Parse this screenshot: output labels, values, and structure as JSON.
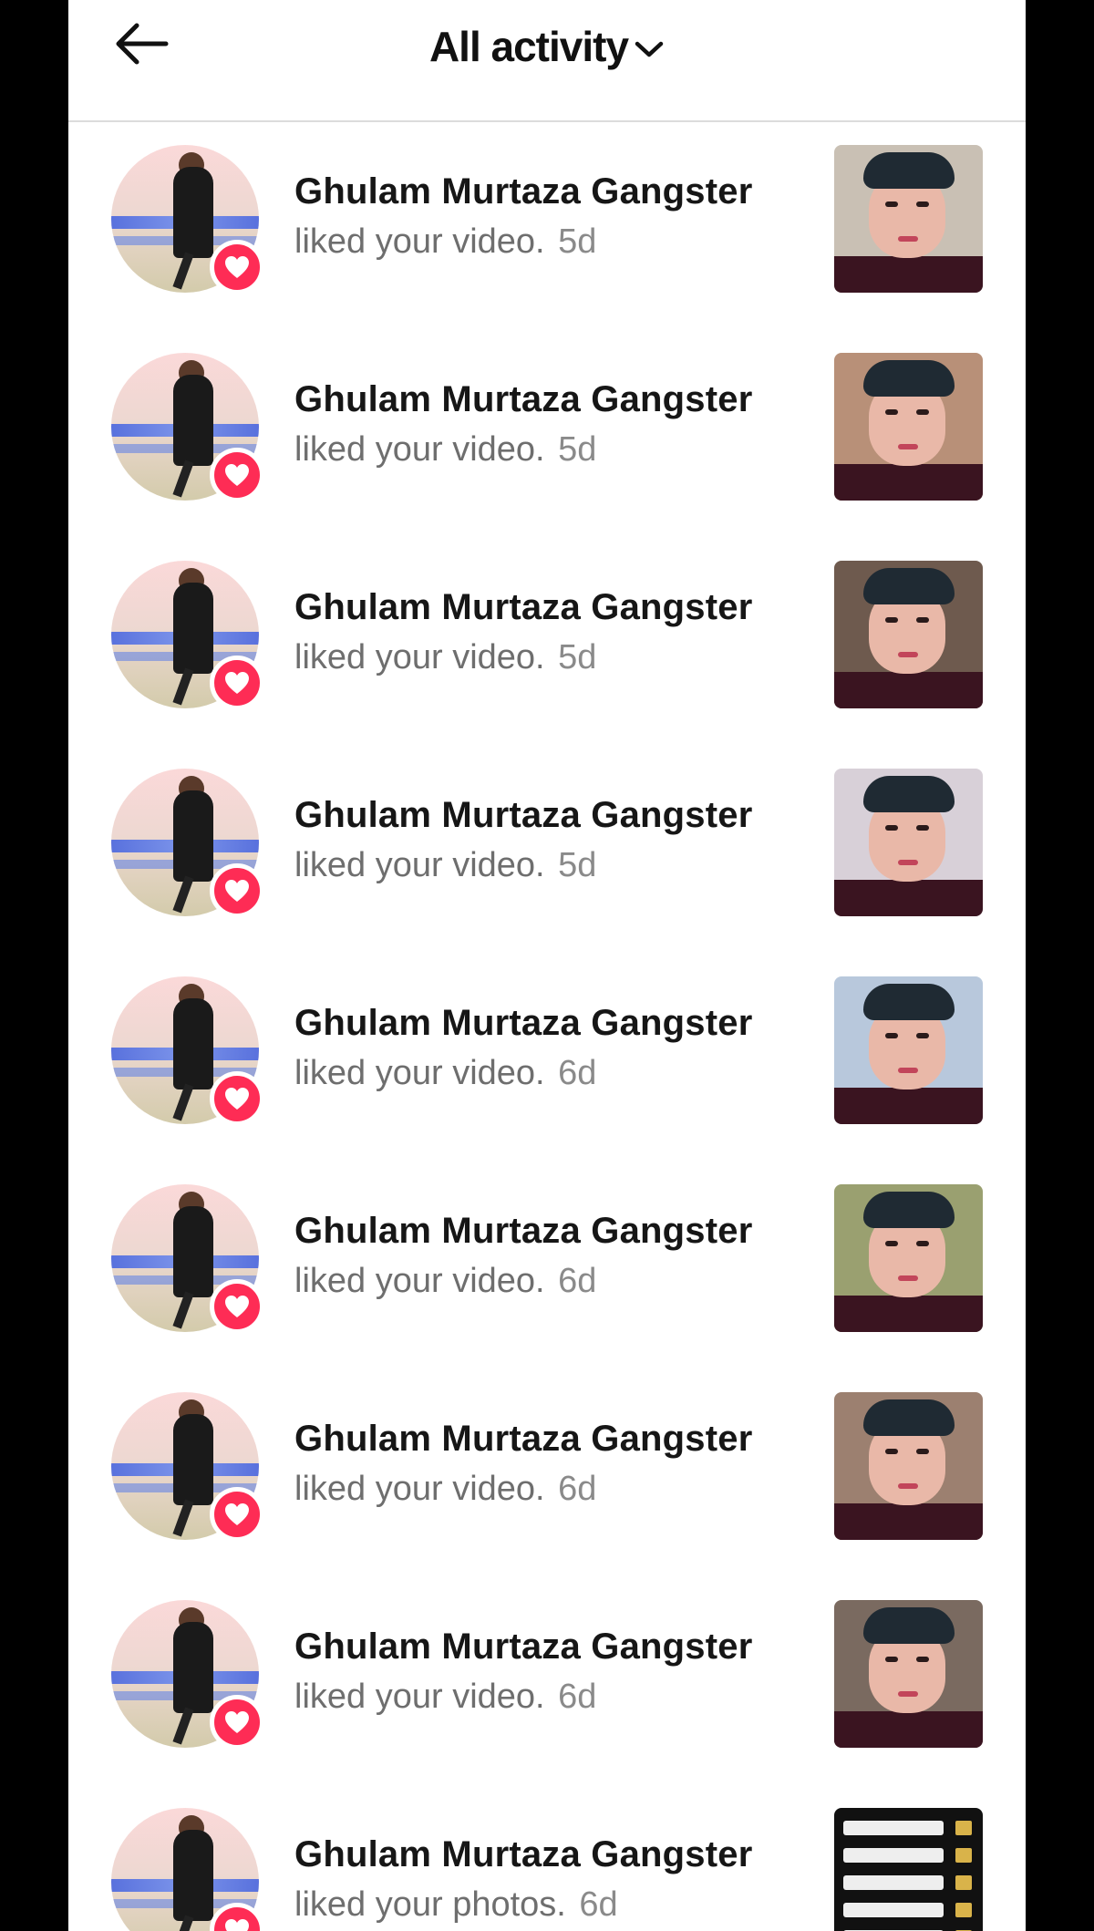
{
  "header": {
    "title": "All activity",
    "back_icon": "arrow-left-icon",
    "dropdown_icon": "chevron-down-icon"
  },
  "colors": {
    "heart_badge": "#fe2c55",
    "name_text": "#161616",
    "sub_text": "#6e6e6e"
  },
  "notifications": [
    {
      "name": "Ghulam Murtaza Gangster",
      "action": "liked your video.",
      "time": "5d",
      "thumb_bg": "#c9c0b4"
    },
    {
      "name": "Ghulam Murtaza Gangster",
      "action": "liked your video.",
      "time": "5d",
      "thumb_bg": "#b89078"
    },
    {
      "name": "Ghulam Murtaza Gangster",
      "action": "liked your video.",
      "time": "5d",
      "thumb_bg": "#6e5a4e"
    },
    {
      "name": "Ghulam Murtaza Gangster",
      "action": "liked your video.",
      "time": "5d",
      "thumb_bg": "#d8d0d8"
    },
    {
      "name": "Ghulam Murtaza Gangster",
      "action": "liked your video.",
      "time": "6d",
      "thumb_bg": "#b8c8dc"
    },
    {
      "name": "Ghulam Murtaza Gangster",
      "action": "liked your video.",
      "time": "6d",
      "thumb_bg": "#9aa070"
    },
    {
      "name": "Ghulam Murtaza Gangster",
      "action": "liked your video.",
      "time": "6d",
      "thumb_bg": "#9c8070"
    },
    {
      "name": "Ghulam Murtaza Gangster",
      "action": "liked your video.",
      "time": "6d",
      "thumb_bg": "#7a6a60"
    },
    {
      "name": "Ghulam Murtaza Gangster",
      "action": "liked your photos.",
      "time": "6d",
      "thumb_bg": "#111111"
    }
  ]
}
